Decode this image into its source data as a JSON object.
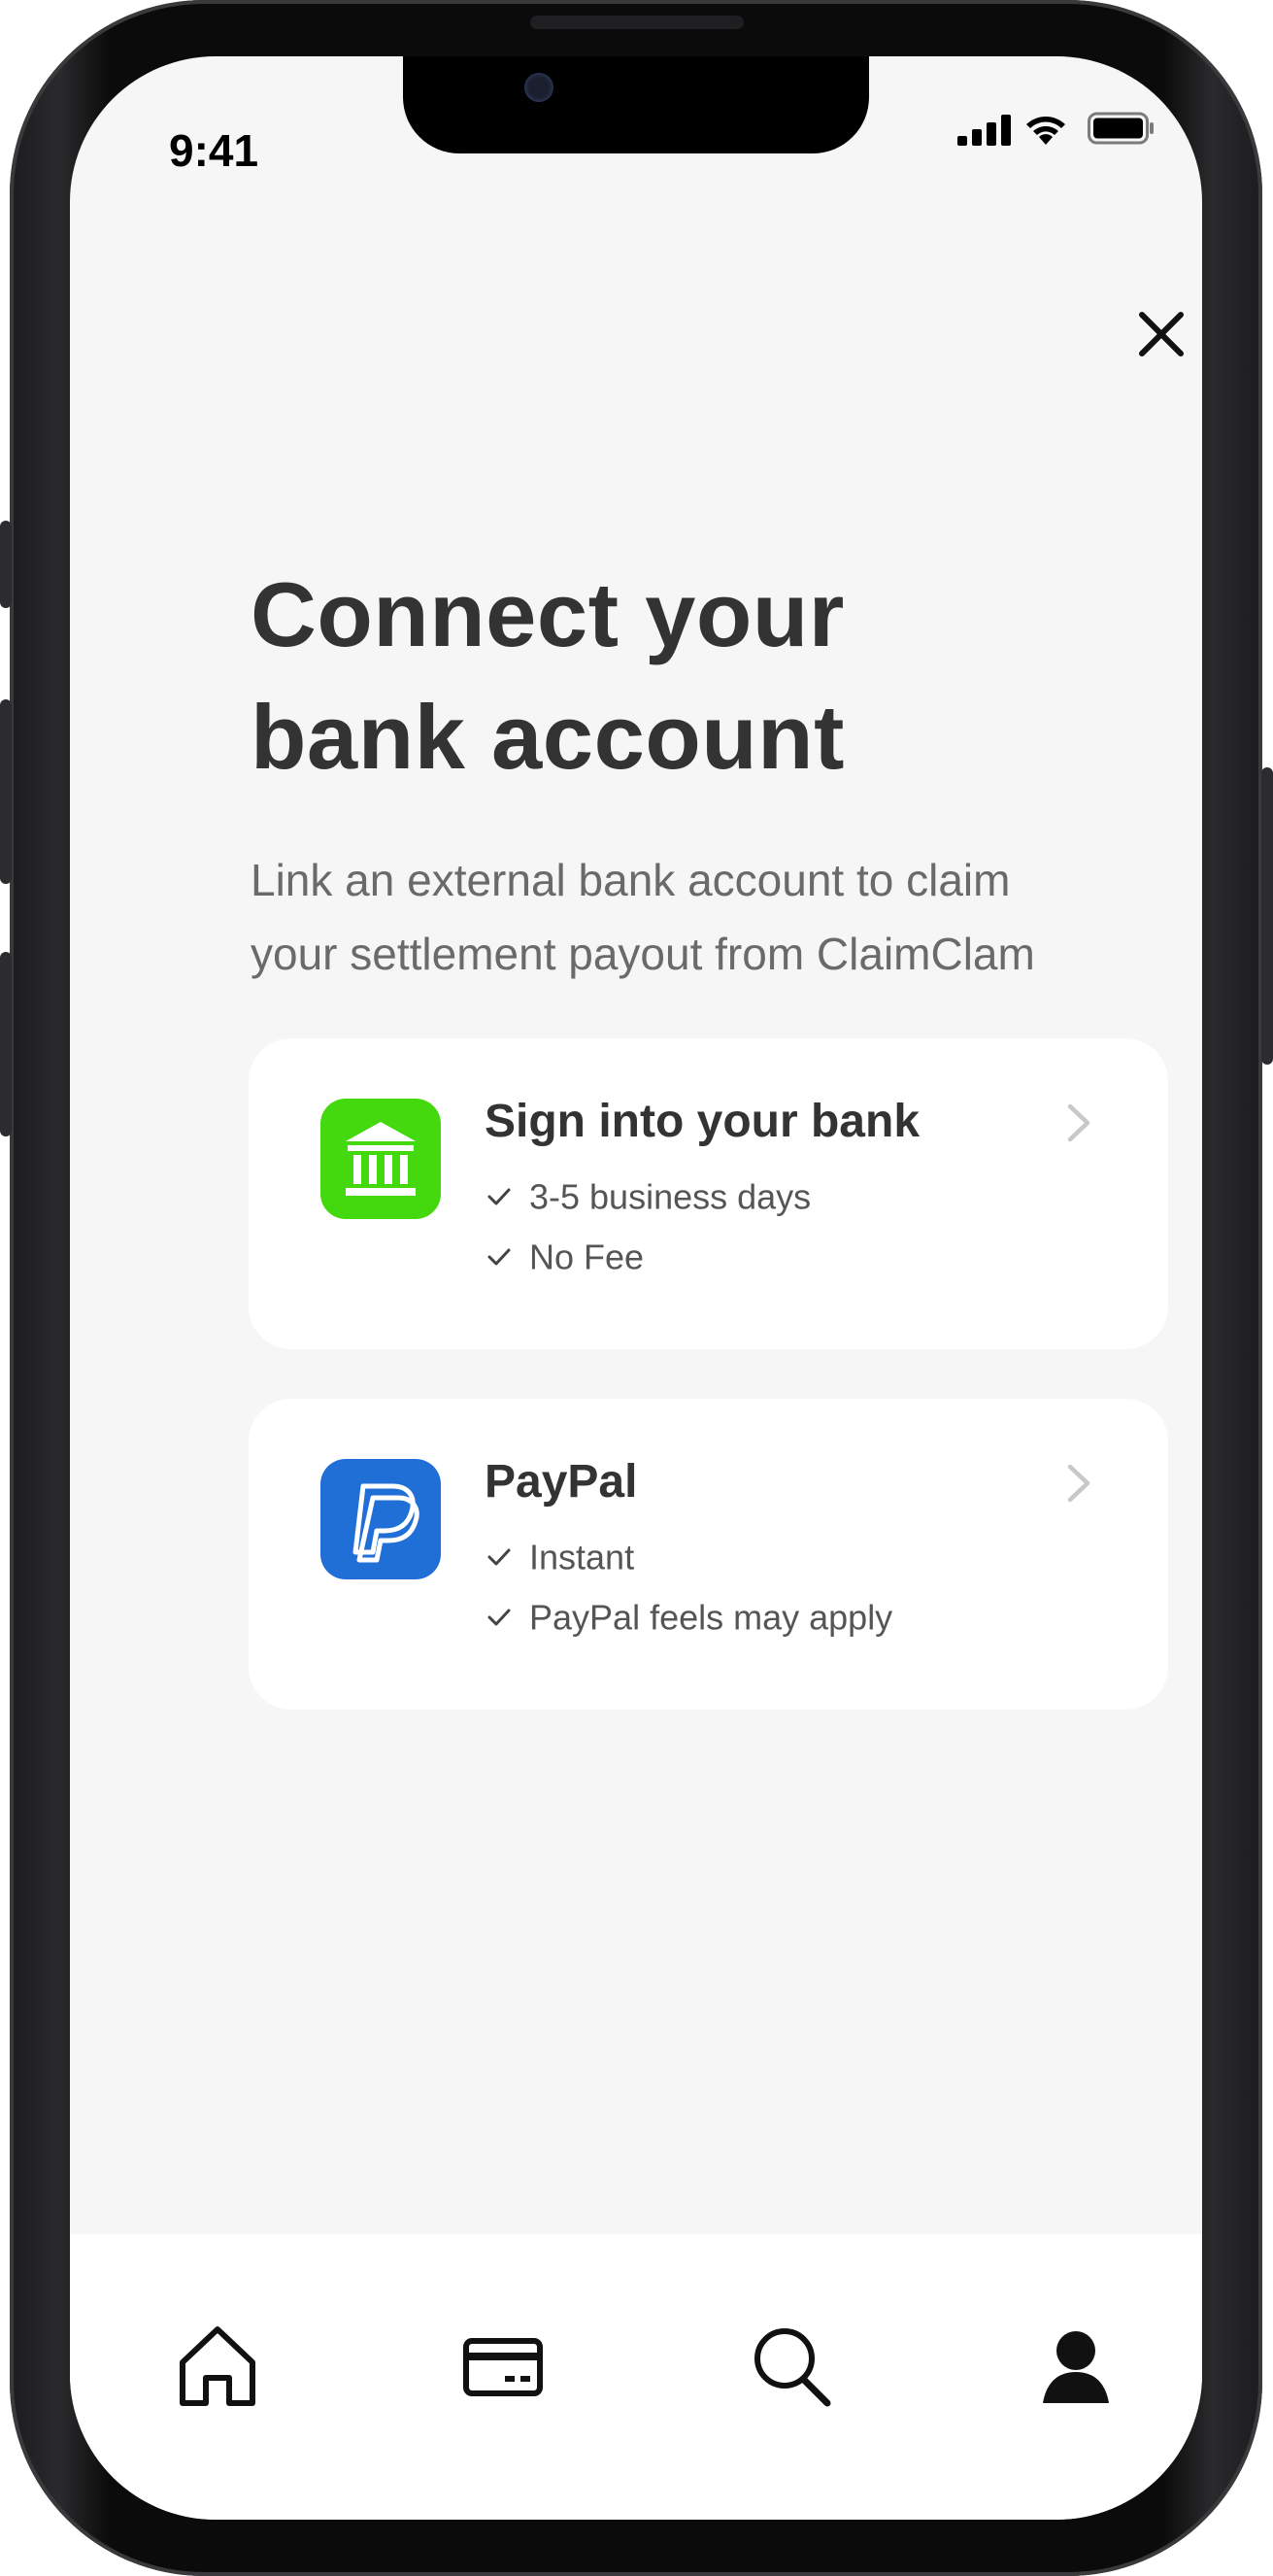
{
  "status_bar": {
    "time": "9:41"
  },
  "header": {
    "title_line1": "Connect your",
    "title_line2": "bank account",
    "subtitle_line1": "Link an external bank account to claim",
    "subtitle_line2": "your settlement payout from ClaimClam"
  },
  "options": [
    {
      "title": "Sign into your bank",
      "features": [
        "3-5 business days",
        "No Fee"
      ],
      "icon": "bank-icon",
      "icon_bg": "#44d90f"
    },
    {
      "title": "PayPal",
      "features": [
        "Instant",
        "PayPal feels may apply"
      ],
      "icon": "paypal-icon",
      "icon_bg": "#1f6fd6"
    }
  ],
  "tabs": [
    "home-icon",
    "card-icon",
    "search-icon",
    "profile-icon"
  ],
  "colors": {
    "background": "#f6f6f6",
    "card": "#ffffff",
    "title": "#333333",
    "subtitle": "#6a6a6a"
  }
}
